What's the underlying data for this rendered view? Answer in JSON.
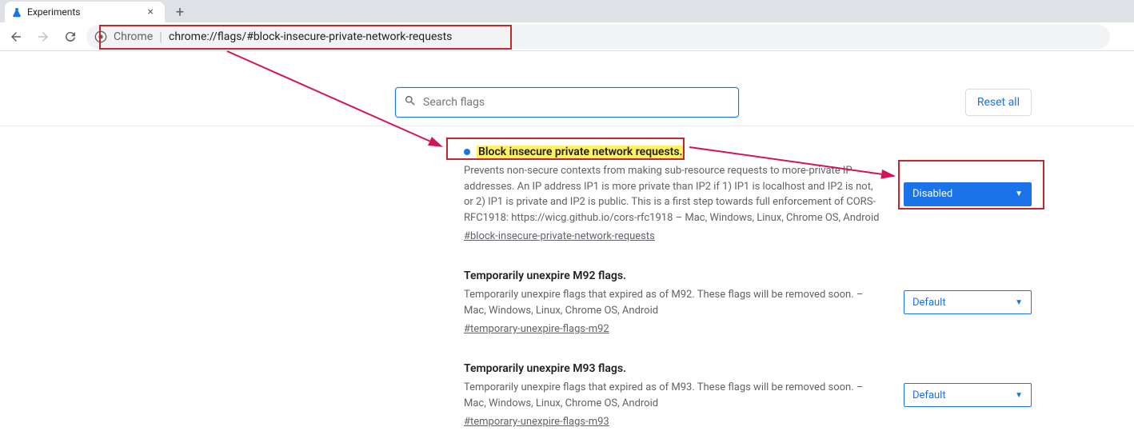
{
  "tab": {
    "title": "Experiments"
  },
  "omnibox": {
    "chip": "Chrome",
    "url": "chrome://flags/#block-insecure-private-network-requests"
  },
  "search": {
    "placeholder": "Search flags"
  },
  "reset": {
    "label": "Reset all"
  },
  "flags": [
    {
      "title": "Block insecure private network requests.",
      "desc": "Prevents non-secure contexts from making sub-resource requests to more-private IP addresses. An IP address IP1 is more private than IP2 if 1) IP1 is localhost and IP2 is not, or 2) IP1 is private and IP2 is public. This is a first step towards full enforcement of CORS-RFC1918: https://wicg.github.io/cors-rfc1918 – Mac, Windows, Linux, Chrome OS, Android",
      "hash": "#block-insecure-private-network-requests",
      "value": "Disabled",
      "highlight": true,
      "active": true
    },
    {
      "title": "Temporarily unexpire M92 flags.",
      "desc": "Temporarily unexpire flags that expired as of M92. These flags will be removed soon. – Mac, Windows, Linux, Chrome OS, Android",
      "hash": "#temporary-unexpire-flags-m92",
      "value": "Default",
      "highlight": false,
      "active": false
    },
    {
      "title": "Temporarily unexpire M93 flags.",
      "desc": "Temporarily unexpire flags that expired as of M93. These flags will be removed soon. – Mac, Windows, Linux, Chrome OS, Android",
      "hash": "#temporary-unexpire-flags-m93",
      "value": "Default",
      "highlight": false,
      "active": false
    }
  ]
}
